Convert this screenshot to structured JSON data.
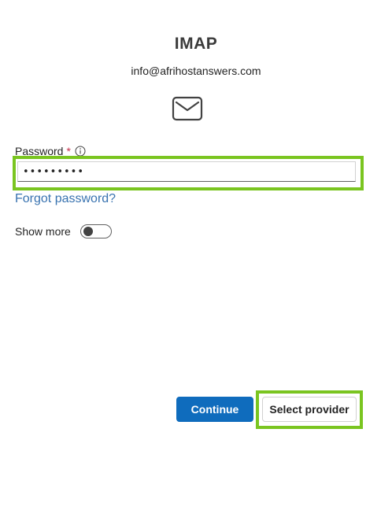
{
  "header": {
    "title": "IMAP",
    "account_email": "info@afrihostanswers.com",
    "icon": "mail-envelope-icon"
  },
  "password": {
    "label": "Password",
    "required_marker": "*",
    "info_icon": "info-icon",
    "value": "•••••••••",
    "forgot_link": "Forgot password?"
  },
  "show_more": {
    "label": "Show more",
    "toggle_on": false
  },
  "actions": {
    "continue_label": "Continue",
    "select_provider_label": "Select provider"
  },
  "colors": {
    "primary": "#0f6cbd",
    "link": "#3973b0",
    "highlight": "#7ac520",
    "required": "#c4314b"
  }
}
